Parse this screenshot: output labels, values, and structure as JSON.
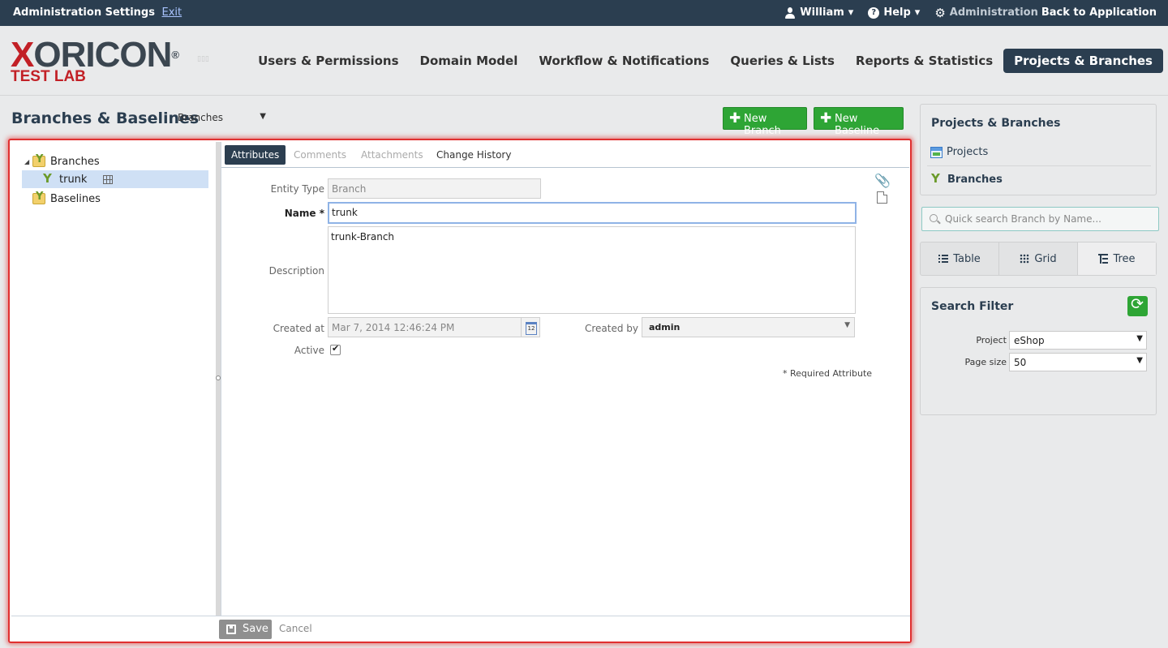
{
  "topbar": {
    "title": "Administration Settings",
    "exit": "Exit",
    "user": "William",
    "help": "Help",
    "admin": "Administration",
    "back": "Back to Application"
  },
  "logo": {
    "main_x": "X",
    "main_rest": "ORICON",
    "reg": "®",
    "sub": "TEST LAB",
    "dots": "▯▯▯"
  },
  "nav": {
    "items": [
      "Users & Permissions",
      "Domain Model",
      "Workflow & Notifications",
      "Queries & Lists",
      "Reports & Statistics",
      "Projects & Branches"
    ],
    "active_index": 5
  },
  "page": {
    "title": "Branches & Baselines",
    "view_select": "Branches"
  },
  "actions": {
    "new_branch": "New Branch",
    "new_baseline": "New Baseline"
  },
  "tree": {
    "root_branches": "Branches",
    "trunk": "trunk",
    "root_baselines": "Baselines"
  },
  "tabs": {
    "attributes": "Attributes",
    "comments": "Comments",
    "attachments": "Attachments",
    "history": "Change History"
  },
  "form": {
    "entity_type_label": "Entity Type",
    "entity_type_value": "Branch",
    "name_label": "Name",
    "name_required": "*",
    "name_value": "trunk",
    "description_label": "Description",
    "description_value": "trunk-Branch",
    "created_at_label": "Created at",
    "created_at_value": "Mar 7, 2014 12:46:24 PM",
    "created_by_label": "Created by",
    "created_by_value": "admin",
    "active_label": "Active",
    "active_checked": true,
    "required_note": "* Required Attribute"
  },
  "footer": {
    "save": "Save",
    "cancel": "Cancel"
  },
  "side": {
    "panel_title": "Projects & Branches",
    "projects": "Projects",
    "branches": "Branches",
    "search_placeholder": "Quick search Branch by Name...",
    "views": [
      "Table",
      "Grid",
      "Tree"
    ],
    "filter_title": "Search Filter",
    "project_label": "Project",
    "project_value": "eShop",
    "page_size_label": "Page size",
    "page_size_value": "50"
  },
  "colors": {
    "dark_nav": "#2b3e50",
    "green": "#2ea535",
    "highlight_frame": "#e03030",
    "brand_red": "#c22026"
  }
}
